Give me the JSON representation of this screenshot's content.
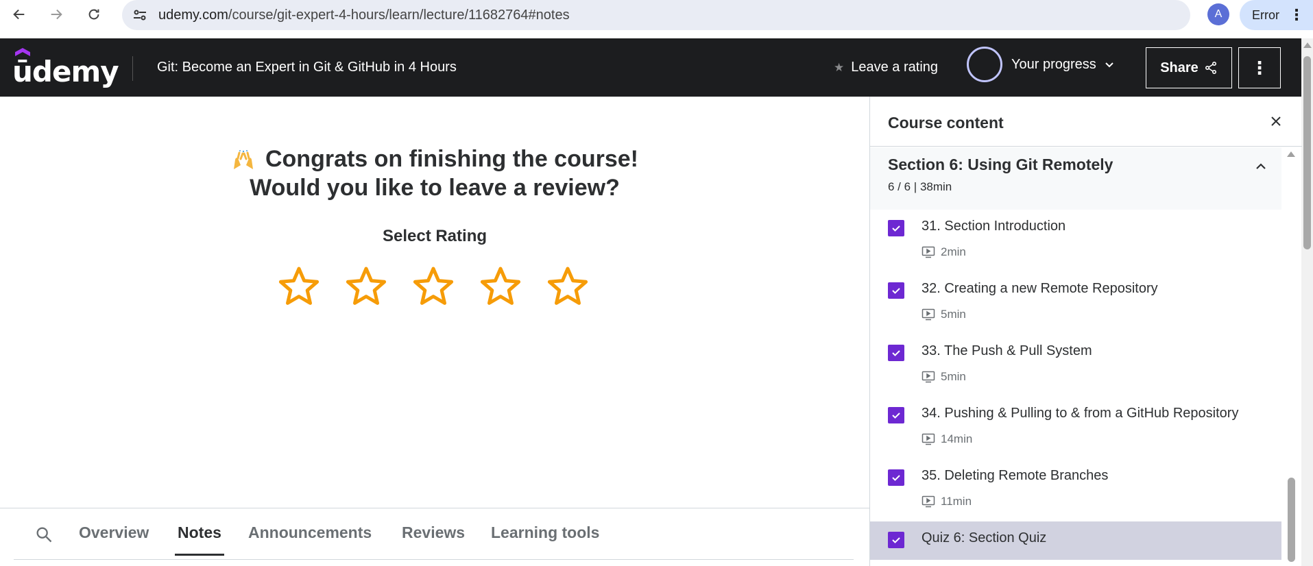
{
  "browser": {
    "url_host": "udemy.com",
    "url_path": "/course/git-expert-4-hours/learn/lecture/11682764#notes",
    "profile_initial": "A",
    "error_label": "Error"
  },
  "header": {
    "logo_text": "ūdemy",
    "course_title": "Git: Become an Expert in Git & GitHub in 4 Hours",
    "rate_label": "Leave a rating",
    "progress_label": "Your progress",
    "share_label": "Share"
  },
  "review": {
    "congrats_line1": "Congrats on finishing the course!",
    "congrats_line2": "Would you like to leave a review?",
    "select_rating": "Select Rating",
    "star_count": 5,
    "star_color": "#f69c08"
  },
  "tabs": [
    {
      "label": "Overview",
      "active": false
    },
    {
      "label": "Notes",
      "active": true
    },
    {
      "label": "Announcements",
      "active": false
    },
    {
      "label": "Reviews",
      "active": false
    },
    {
      "label": "Learning tools",
      "active": false
    }
  ],
  "sidebar": {
    "title": "Course content",
    "section": {
      "title": "Section 6: Using Git Remotely",
      "meta": "6 / 6 | 38min"
    },
    "lectures": [
      {
        "title": "31. Section Introduction",
        "duration": "2min",
        "completed": true
      },
      {
        "title": "32. Creating a new Remote Repository",
        "duration": "5min",
        "completed": true
      },
      {
        "title": "33. The Push & Pull System",
        "duration": "5min",
        "completed": true
      },
      {
        "title": "34. Pushing & Pulling to & from a GitHub Repository",
        "duration": "14min",
        "completed": true
      },
      {
        "title": "35. Deleting Remote Branches",
        "duration": "11min",
        "completed": true
      },
      {
        "title": "Quiz 6: Section Quiz",
        "duration": "",
        "completed": true,
        "current": true
      }
    ]
  },
  "colors": {
    "header_bg": "#1c1d1f",
    "accent_purple": "#6d28d2",
    "current_row_bg": "#d1d2e0",
    "progress_ring": "#c0c4fc"
  }
}
